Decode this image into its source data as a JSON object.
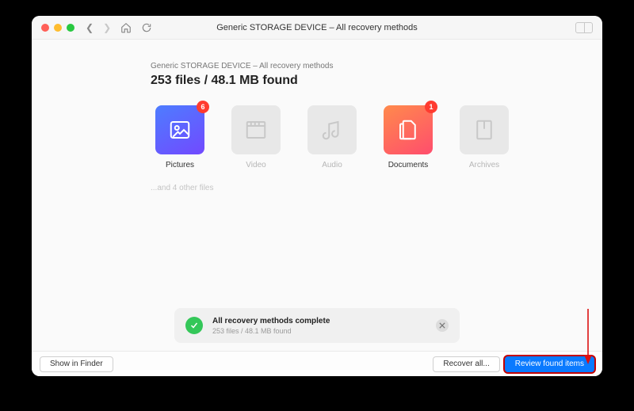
{
  "titlebar": {
    "title": "Generic STORAGE DEVICE – All recovery methods"
  },
  "summary": {
    "subtitle": "Generic STORAGE DEVICE – All recovery methods",
    "headline": "253 files / 48.1 MB found"
  },
  "tiles": [
    {
      "label": "Pictures",
      "badge": "6",
      "icon": "image-icon",
      "active": true,
      "variant": "blue"
    },
    {
      "label": "Video",
      "badge": "",
      "icon": "video-icon",
      "active": false,
      "variant": ""
    },
    {
      "label": "Audio",
      "badge": "",
      "icon": "audio-icon",
      "active": false,
      "variant": ""
    },
    {
      "label": "Documents",
      "badge": "1",
      "icon": "document-icon",
      "active": true,
      "variant": "orange"
    },
    {
      "label": "Archives",
      "badge": "",
      "icon": "archive-icon",
      "active": false,
      "variant": ""
    }
  ],
  "extra_note": "...and 4 other files",
  "status": {
    "title": "All recovery methods complete",
    "subtitle": "253 files / 48.1 MB found"
  },
  "footer": {
    "show_in_finder": "Show in Finder",
    "recover_all": "Recover all...",
    "review": "Review found items"
  }
}
